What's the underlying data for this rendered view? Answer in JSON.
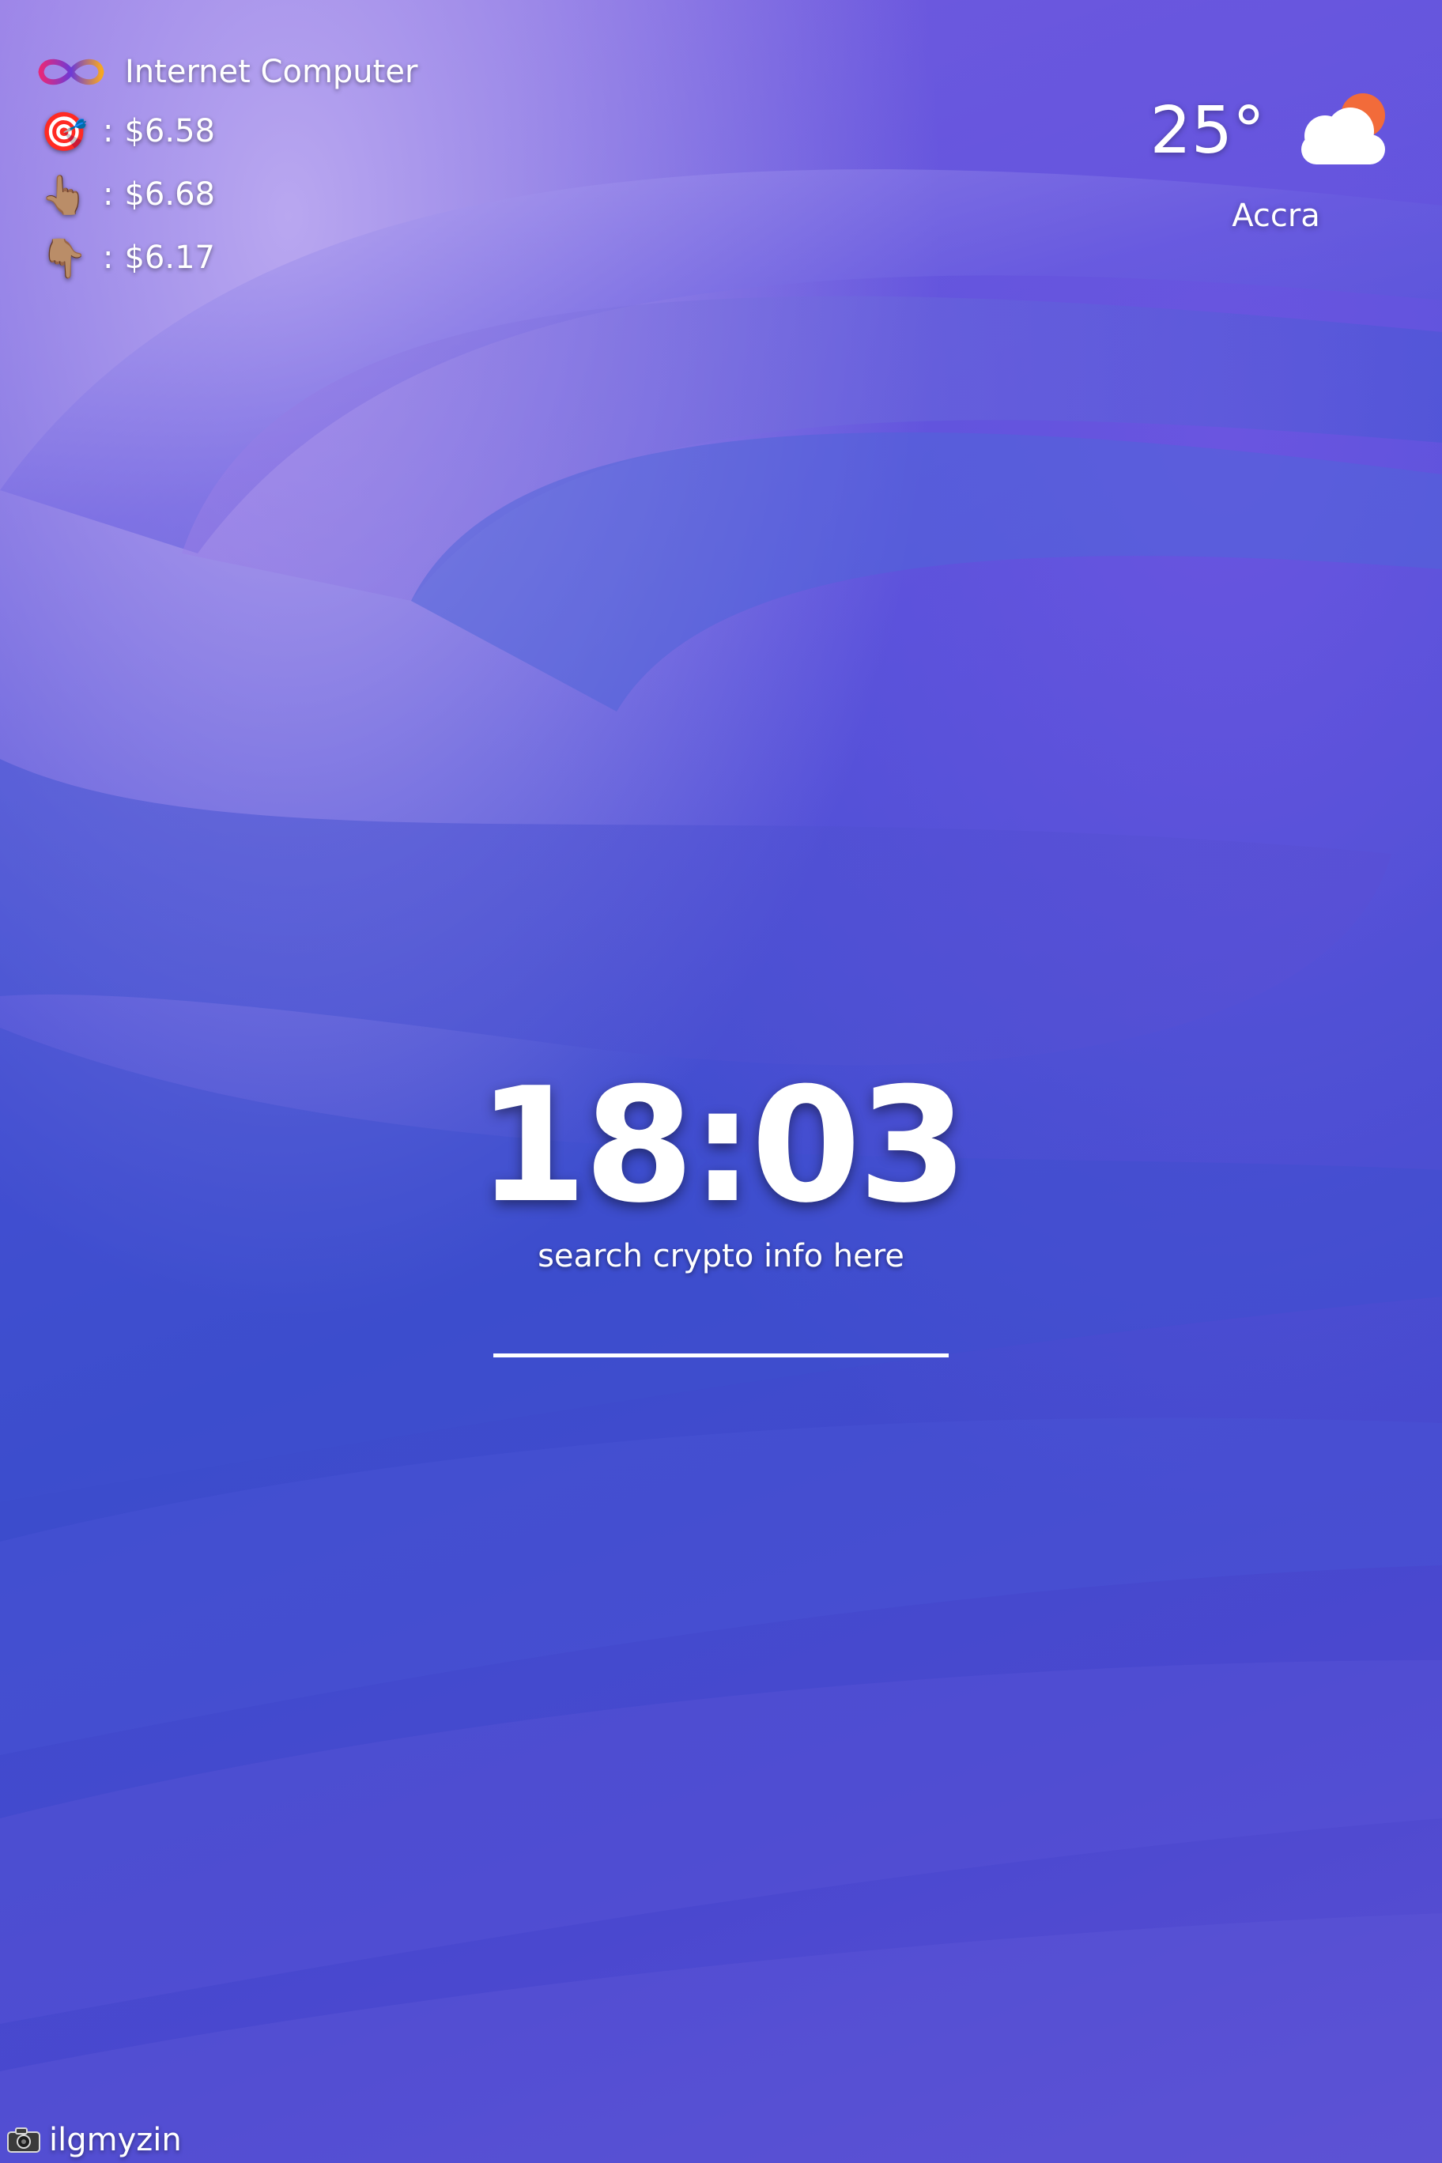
{
  "ticker": {
    "title": "Internet Computer",
    "logo_icon": "infinity-logo-icon",
    "rows": [
      {
        "icon": "target-icon",
        "emoji": "🎯",
        "separator": ":",
        "value": "$6.58"
      },
      {
        "icon": "pointing-up-icon",
        "emoji": "👆🏽",
        "separator": ":",
        "value": "$6.68"
      },
      {
        "icon": "pointing-down-icon",
        "emoji": "👇🏽",
        "separator": ":",
        "value": "$6.17"
      }
    ]
  },
  "weather": {
    "temperature": "25°",
    "city": "Accra",
    "icon": "partly-cloudy-icon"
  },
  "clock": {
    "time": "18:03"
  },
  "search": {
    "hint": "search crypto info here",
    "value": ""
  },
  "credit": {
    "icon": "camera-icon",
    "name": "ilgmyzin"
  },
  "colors": {
    "background_primary": "#4b4fd6",
    "background_light": "#b9a7f0",
    "text": "#ffffff",
    "sun": "#f26b3a"
  }
}
